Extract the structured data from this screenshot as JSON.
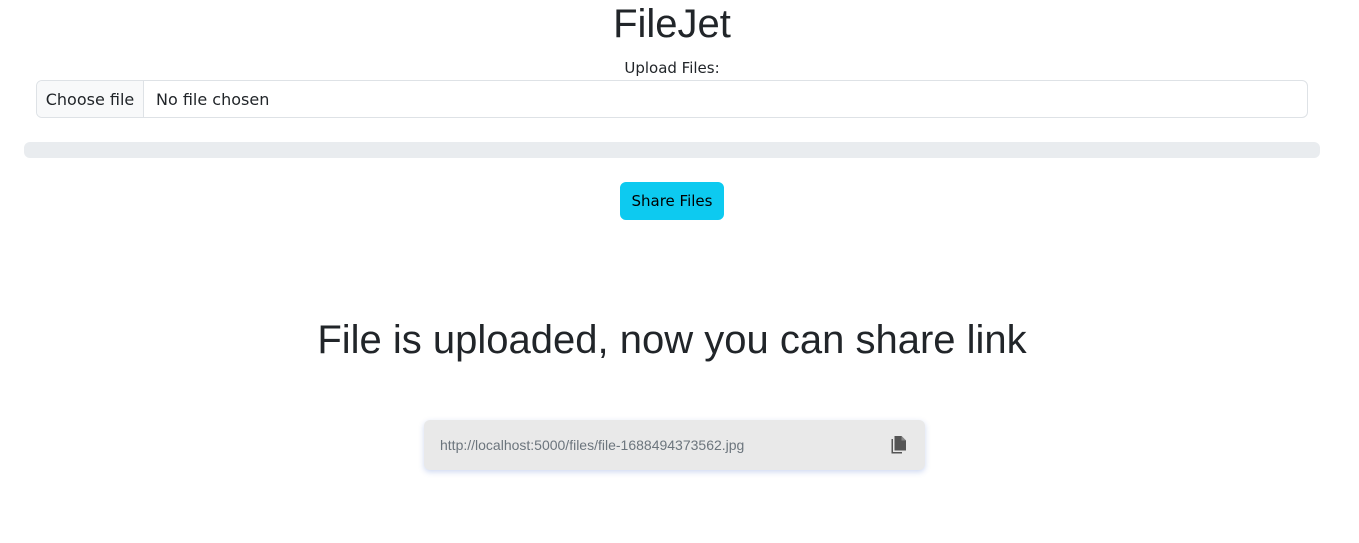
{
  "app": {
    "title": "FileJet"
  },
  "upload": {
    "label": "Upload Files:",
    "choose_button": "Choose file",
    "file_status": "No file chosen",
    "progress_fraction": 0
  },
  "actions": {
    "share_label": "Share Files"
  },
  "result": {
    "heading": "File is uploaded, now you can share link",
    "link": "http://localhost:5000/files/file-1688494373562.jpg",
    "copy_icon": "copy-icon"
  },
  "colors": {
    "share_button": "#0dcaf0",
    "progress_track": "#e9ecef",
    "link_box": "#e9e9e9"
  }
}
